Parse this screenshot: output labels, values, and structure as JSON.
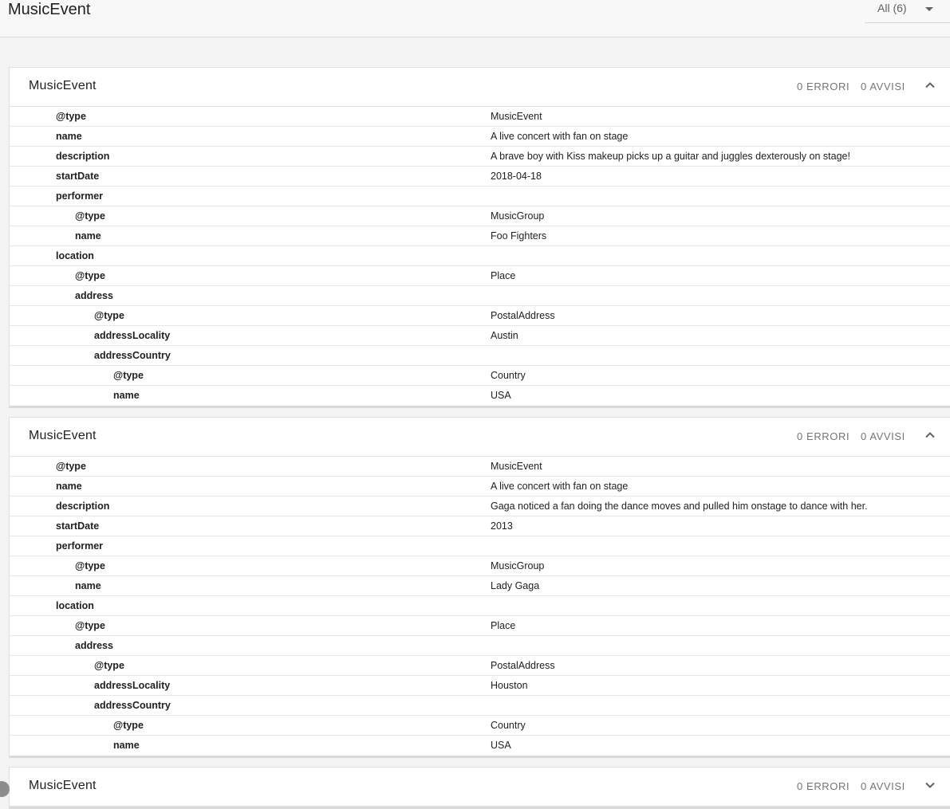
{
  "header": {
    "title": "MusicEvent",
    "filter_label": "All (6)"
  },
  "cards": [
    {
      "title": "MusicEvent",
      "errors": "0 ERRORI",
      "warnings": "0 AVVISI",
      "expanded": true,
      "rows": [
        {
          "key": "@type",
          "value": "MusicEvent",
          "level": 0
        },
        {
          "key": "name",
          "value": "A live concert with fan on stage",
          "level": 0
        },
        {
          "key": "description",
          "value": "A brave boy with Kiss makeup picks up a guitar and juggles dexterously on stage!",
          "level": 0
        },
        {
          "key": "startDate",
          "value": "2018-04-18",
          "level": 0
        },
        {
          "key": "performer",
          "value": "",
          "level": 0
        },
        {
          "key": "@type",
          "value": "MusicGroup",
          "level": 1
        },
        {
          "key": "name",
          "value": "Foo Fighters",
          "level": 1
        },
        {
          "key": "location",
          "value": "",
          "level": 0
        },
        {
          "key": "@type",
          "value": "Place",
          "level": 1
        },
        {
          "key": "address",
          "value": "",
          "level": 1
        },
        {
          "key": "@type",
          "value": "PostalAddress",
          "level": 2
        },
        {
          "key": "addressLocality",
          "value": "Austin",
          "level": 2
        },
        {
          "key": "addressCountry",
          "value": "",
          "level": 2
        },
        {
          "key": "@type",
          "value": "Country",
          "level": 3
        },
        {
          "key": "name",
          "value": "USA",
          "level": 3
        }
      ]
    },
    {
      "title": "MusicEvent",
      "errors": "0 ERRORI",
      "warnings": "0 AVVISI",
      "expanded": true,
      "rows": [
        {
          "key": "@type",
          "value": "MusicEvent",
          "level": 0
        },
        {
          "key": "name",
          "value": "A live concert with fan on stage",
          "level": 0
        },
        {
          "key": "description",
          "value": "Gaga noticed a fan doing the dance moves and pulled him onstage to dance with her.",
          "level": 0
        },
        {
          "key": "startDate",
          "value": "2013",
          "level": 0
        },
        {
          "key": "performer",
          "value": "",
          "level": 0
        },
        {
          "key": "@type",
          "value": "MusicGroup",
          "level": 1
        },
        {
          "key": "name",
          "value": "Lady Gaga",
          "level": 1
        },
        {
          "key": "location",
          "value": "",
          "level": 0
        },
        {
          "key": "@type",
          "value": "Place",
          "level": 1
        },
        {
          "key": "address",
          "value": "",
          "level": 1
        },
        {
          "key": "@type",
          "value": "PostalAddress",
          "level": 2
        },
        {
          "key": "addressLocality",
          "value": "Houston",
          "level": 2
        },
        {
          "key": "addressCountry",
          "value": "",
          "level": 2
        },
        {
          "key": "@type",
          "value": "Country",
          "level": 3
        },
        {
          "key": "name",
          "value": "USA",
          "level": 3
        }
      ]
    },
    {
      "title": "MusicEvent",
      "errors": "0 ERRORI",
      "warnings": "0 AVVISI",
      "expanded": false,
      "rows": []
    }
  ],
  "icons": {
    "collapse": "chevron-up-icon",
    "expand": "chevron-down-icon",
    "filter_dropdown": "caret-down-icon"
  },
  "colors": {
    "background": "#f3f3f3",
    "card": "#ffffff",
    "muted_text": "#757575",
    "border": "#e0e0e0"
  }
}
